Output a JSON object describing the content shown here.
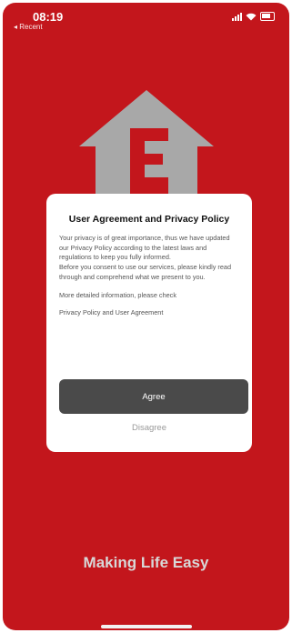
{
  "status_bar": {
    "time": "08:19",
    "back_label": "◂ Recent",
    "icons": [
      "cellular-signal-icon",
      "wifi-icon",
      "battery-icon"
    ]
  },
  "logo": {
    "name": "house-e-logo-icon",
    "color": "#a8a8a8"
  },
  "dialog": {
    "title": "User Agreement and Privacy Policy",
    "paragraph1": "Your privacy is of great importance, thus we have updated our Privacy Policy according to the latest laws and regulations to keep you fully informed.",
    "paragraph2": "Before you consent to use our services, please kindly read through and comprehend what we present to you.",
    "paragraph3": "More detailed information, please check",
    "privacy_link": "Privacy Policy",
    "and_text": "and",
    "agreement_link": "User Agreement",
    "agree_label": "Agree",
    "disagree_label": "Disagree"
  },
  "tagline": "Making Life Easy",
  "colors": {
    "background": "#c3161c",
    "logo": "#a8a8a8",
    "link": "#1e9a3c",
    "agree_button": "#4a4a4a"
  }
}
